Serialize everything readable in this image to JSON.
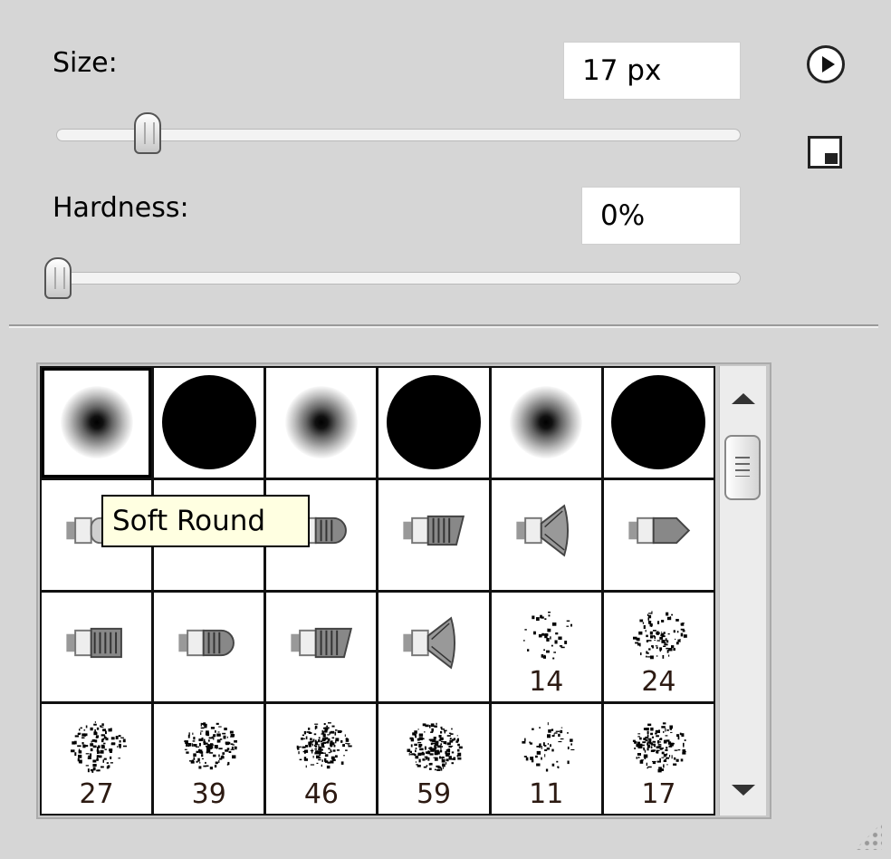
{
  "size": {
    "label": "Size:",
    "value": "17 px",
    "slider_fraction": 0.09
  },
  "hardness": {
    "label": "Hardness:",
    "value": "0%",
    "slider_fraction": 0.0
  },
  "icons": {
    "menu": "flyout-menu-arrow-icon",
    "new_preset": "new-brush-preset-icon"
  },
  "tooltip": "Soft Round",
  "brushes": [
    {
      "type": "soft-round",
      "number": ""
    },
    {
      "type": "hard-round",
      "number": ""
    },
    {
      "type": "soft-round",
      "number": ""
    },
    {
      "type": "hard-round",
      "number": ""
    },
    {
      "type": "soft-round",
      "number": ""
    },
    {
      "type": "hard-round",
      "number": ""
    },
    {
      "type": "round-bristle",
      "number": ""
    },
    {
      "type": "flat-bristle",
      "number": ""
    },
    {
      "type": "round-blunt-bristle",
      "number": ""
    },
    {
      "type": "angle-bristle",
      "number": ""
    },
    {
      "type": "fan-bristle",
      "number": ""
    },
    {
      "type": "point-bristle",
      "number": ""
    },
    {
      "type": "flat-bristle",
      "number": ""
    },
    {
      "type": "round-blunt-bristle",
      "number": ""
    },
    {
      "type": "angle-bristle",
      "number": ""
    },
    {
      "type": "fan-bristle",
      "number": ""
    },
    {
      "type": "spatter",
      "number": "14"
    },
    {
      "type": "spatter",
      "number": "24"
    },
    {
      "type": "spatter",
      "number": "27"
    },
    {
      "type": "spatter",
      "number": "39"
    },
    {
      "type": "spatter",
      "number": "46"
    },
    {
      "type": "spatter",
      "number": "59"
    },
    {
      "type": "spatter",
      "number": "11"
    },
    {
      "type": "spatter",
      "number": "17"
    }
  ]
}
